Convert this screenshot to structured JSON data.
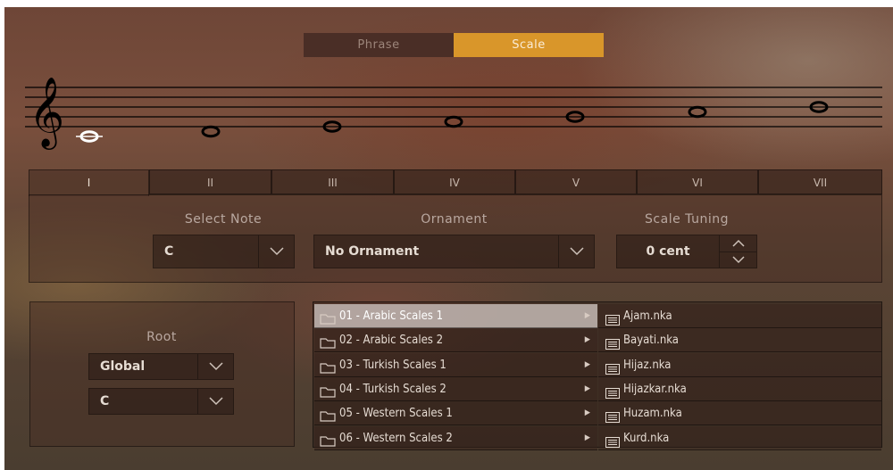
{
  "mode_tabs": {
    "phrase": "Phrase",
    "scale": "Scale",
    "active": "scale"
  },
  "degree_tabs": [
    "I",
    "II",
    "III",
    "IV",
    "V",
    "VI",
    "VII"
  ],
  "active_degree": "I",
  "note_panel": {
    "select_note_label": "Select Note",
    "select_note_value": "C",
    "ornament_label": "Ornament",
    "ornament_value": "No Ornament",
    "scale_tuning_label": "Scale Tuning",
    "scale_tuning_value": "0 cent"
  },
  "root_panel": {
    "label": "Root",
    "mode_value": "Global",
    "note_value": "C"
  },
  "browser": {
    "folders": [
      "01 - Arabic Scales 1",
      "02 - Arabic Scales 2",
      "03 - Turkish Scales 1",
      "04 - Turkish Scales 2",
      "05 - Western Scales 1",
      "06 - Western Scales 2"
    ],
    "selected_folder": "01 - Arabic Scales 1",
    "files": [
      "Ajam.nka",
      "Bayati.nka",
      "Hijaz.nka",
      "Hijazkar.nka",
      "Huzam.nka",
      "Kurd.nka"
    ]
  },
  "colors": {
    "accent": "#d9962a",
    "text": "#e6dcd3",
    "label": "#b9a8a0"
  },
  "icons": {
    "clef": "treble-clef-icon",
    "folder": "folder-icon",
    "file": "list-file-icon",
    "dropdown": "chevron-down-icon"
  }
}
